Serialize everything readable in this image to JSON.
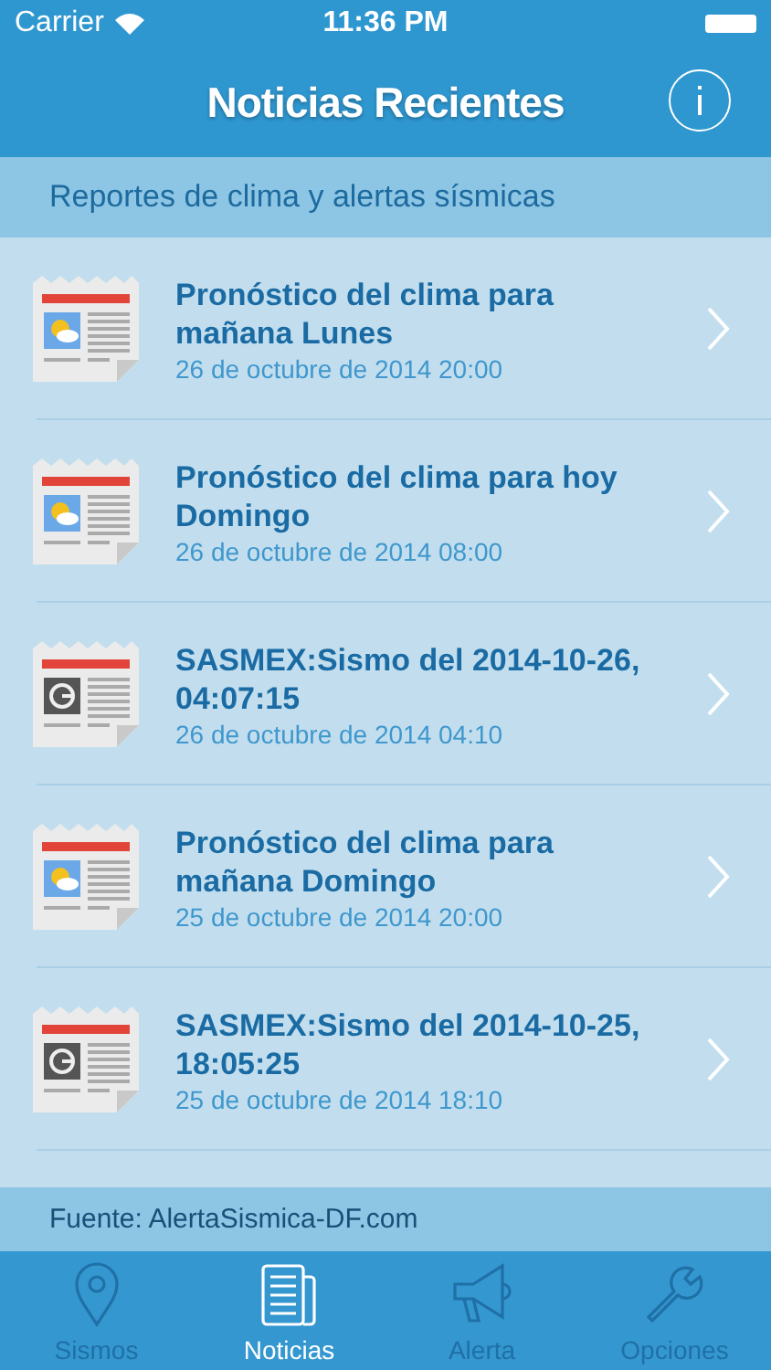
{
  "status_bar": {
    "carrier": "Carrier",
    "time": "11:36 PM"
  },
  "nav": {
    "title": "Noticias Recientes"
  },
  "section_header": "Reportes de clima y alertas sísmicas",
  "rows": [
    {
      "kind": "weather",
      "title": "Pronóstico del clima para mañana Lunes",
      "date": "26 de octubre de 2014 20:00"
    },
    {
      "kind": "weather",
      "title": "Pronóstico del clima para hoy Domingo",
      "date": "26 de octubre de 2014 08:00"
    },
    {
      "kind": "press",
      "title": "SASMEX:Sismo del 2014-10-26, 04:07:15",
      "date": "26 de octubre de 2014 04:10"
    },
    {
      "kind": "weather",
      "title": "Pronóstico del clima para mañana Domingo",
      "date": "25 de octubre de 2014 20:00"
    },
    {
      "kind": "press",
      "title": "SASMEX:Sismo del 2014-10-25, 18:05:25",
      "date": "25 de octubre de 2014 18:10"
    }
  ],
  "footer": "Fuente: AlertaSismica-DF.com",
  "tabs": [
    {
      "kind": "pin",
      "label": "Sismos",
      "selected": false
    },
    {
      "kind": "news",
      "label": "Noticias",
      "selected": true
    },
    {
      "kind": "megaphone",
      "label": "Alerta",
      "selected": false
    },
    {
      "kind": "wrench",
      "label": "Opciones",
      "selected": false
    }
  ]
}
